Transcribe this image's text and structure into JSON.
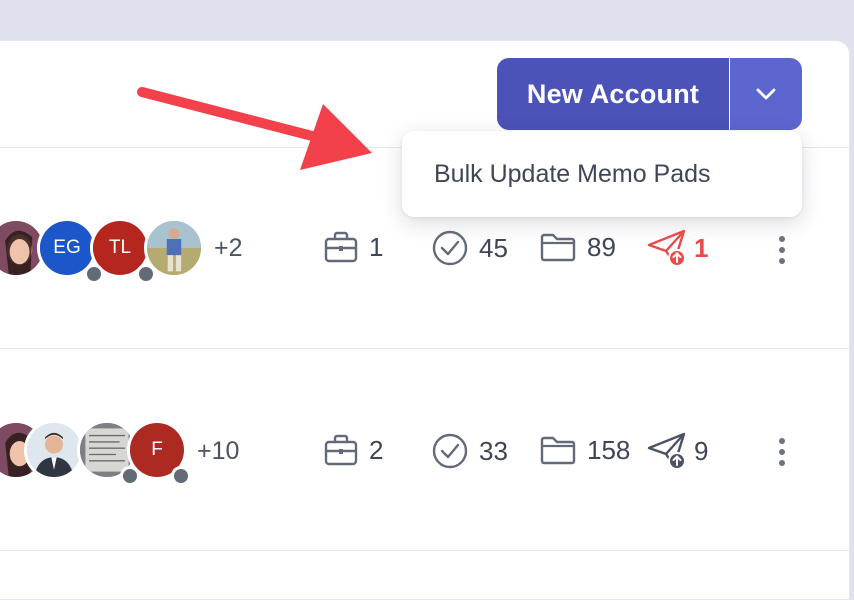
{
  "header": {
    "new_account_label": "New Account",
    "split_icon": "chevron-down-icon"
  },
  "dropdown": {
    "items": [
      {
        "label": "Bulk Update Memo Pads"
      }
    ]
  },
  "annotation": {
    "type": "arrow",
    "color": "#f2414b"
  },
  "rows": [
    {
      "avatars": [
        {
          "kind": "photo",
          "initials": "",
          "bg": "#d7a3a5"
        },
        {
          "kind": "initials",
          "initials": "EG",
          "bg": "#1c57c9"
        },
        {
          "kind": "initials",
          "initials": "TL",
          "bg": "#b5261e"
        },
        {
          "kind": "photo",
          "initials": "",
          "bg": "#9fb7a2"
        }
      ],
      "more": "+2",
      "accounts": "1",
      "tasks": "45",
      "files": "89",
      "sent": "1",
      "sent_alert": true
    },
    {
      "avatars": [
        {
          "kind": "photo",
          "initials": "",
          "bg": "#d7a3a5"
        },
        {
          "kind": "photo",
          "initials": "",
          "bg": "#c9d4df"
        },
        {
          "kind": "photo",
          "initials": "",
          "bg": "#8e9094"
        },
        {
          "kind": "initials",
          "initials": "F",
          "bg": "#ad2a22"
        }
      ],
      "more": "+10",
      "accounts": "2",
      "tasks": "33",
      "files": "158",
      "sent": "9",
      "sent_alert": false
    }
  ],
  "colors": {
    "primary": "#4b53b8",
    "primary_light": "#5c66cf",
    "alert": "#e94b4b",
    "status_dot": "#636a78"
  }
}
